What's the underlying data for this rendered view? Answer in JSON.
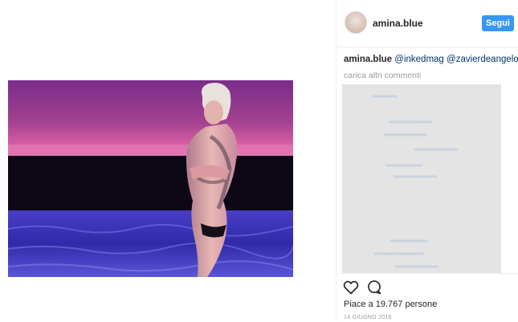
{
  "post": {
    "username": "amina.blue",
    "follow_label": "Segui",
    "caption_user": "amina.blue",
    "caption_mentions": [
      "@inkedmag",
      "@zavierdeangelo"
    ],
    "load_more_label": "carica altri commenti",
    "likes_text": "Piace a 19.767 persone",
    "date_text": "14 GIUGNO 2016"
  },
  "icons": {
    "like": "heart-icon",
    "comment": "comment-icon"
  },
  "colors": {
    "follow_button": "#3897f0",
    "mention": "#003569",
    "muted_text": "#999999",
    "comments_placeholder": "#e4e4e4"
  }
}
